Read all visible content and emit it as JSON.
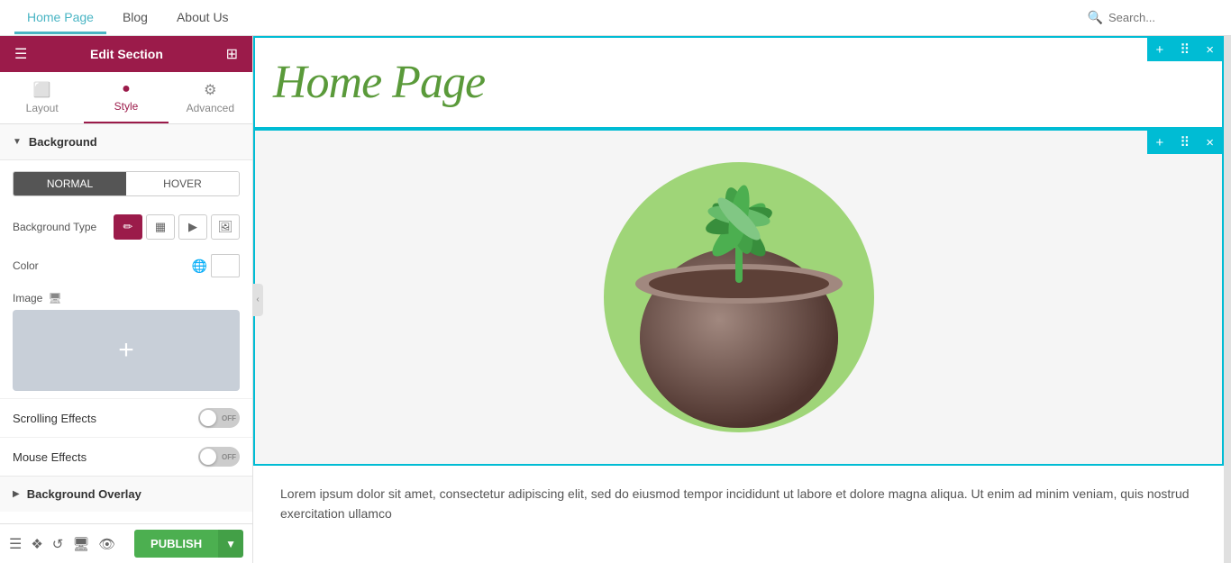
{
  "header": {
    "title": "Edit Section",
    "menu_icon": "☰",
    "grid_icon": "⊞"
  },
  "tabs": {
    "layout": {
      "label": "Layout",
      "icon": "⬜"
    },
    "style": {
      "label": "Style",
      "icon": "●",
      "active": true
    },
    "advanced": {
      "label": "Advanced",
      "icon": "⚙"
    }
  },
  "nav": {
    "tabs": [
      "Home Page",
      "Blog",
      "About Us"
    ],
    "active_tab": "Home Page",
    "search_placeholder": "Search..."
  },
  "background_section": {
    "title": "Background",
    "normal_label": "NORMAL",
    "hover_label": "HOVER",
    "background_type_label": "Background Type",
    "bg_type_icons": [
      "✏",
      "▦",
      "▶",
      "🖼"
    ],
    "color_label": "Color",
    "image_label": "Image"
  },
  "effects": {
    "scrolling_effects": {
      "label": "Scrolling Effects",
      "state": "OFF"
    },
    "mouse_effects": {
      "label": "Mouse Effects",
      "state": "OFF"
    }
  },
  "background_overlay": {
    "title": "Background Overlay"
  },
  "toolbar": {
    "publish_label": "PUBLISH",
    "dropdown_icon": "▼"
  },
  "canvas": {
    "home_page_title": "Home Page",
    "about_us_tab": "About Us",
    "lorem_text": "Lorem ipsum dolor sit amet, consectetur adipiscing elit, sed do eiusmod tempor incididunt ut labore et dolore magna aliqua. Ut enim ad minim veniam, quis nostrud exercitation ullamco"
  },
  "section_toolbar": {
    "add_icon": "+",
    "move_icon": "⠿",
    "close_icon": "×"
  }
}
